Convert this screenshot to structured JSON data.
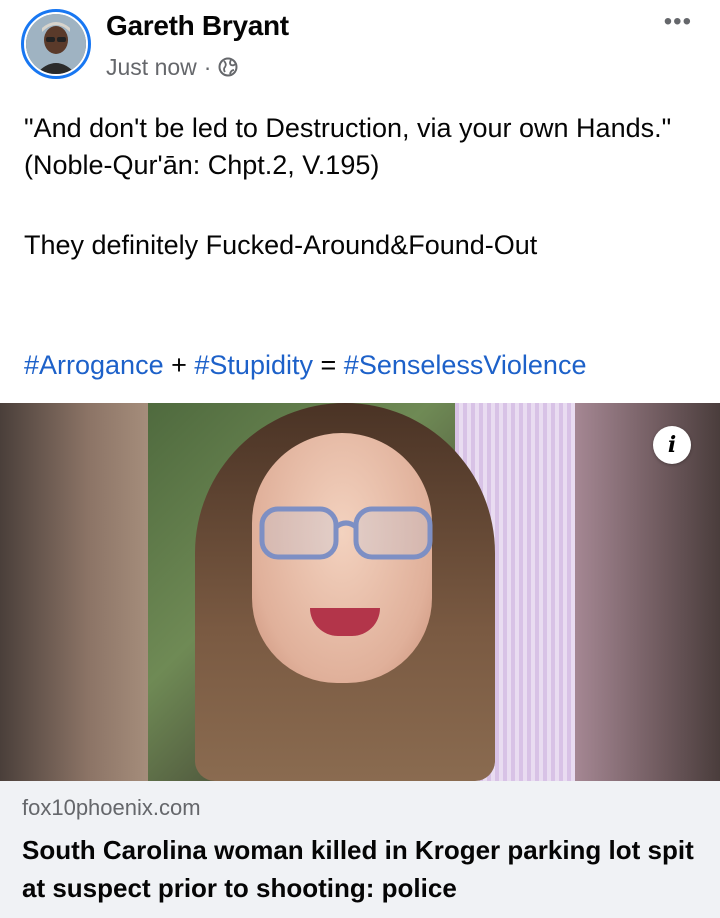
{
  "post": {
    "author": "Gareth Bryant",
    "timestamp": "Just now",
    "separator": "·",
    "audience_icon": "globe-icon",
    "more_icon": "ellipsis-icon",
    "more_label": "•••",
    "lines": [
      "\"And don't be led to Destruction, via your own Hands.\"",
      "(Noble-Qur'ān: Chpt.2, V.195)",
      "They definitely Fucked-Around&Found-Out"
    ],
    "hashtags": [
      "#Arrogance",
      "#Stupidity",
      "#SenselessViolence"
    ],
    "operators": [
      "+",
      "="
    ]
  },
  "link": {
    "info_label": "i",
    "domain": "fox10phoenix.com",
    "headline": "South Carolina woman killed in Kroger parking lot spit at suspect prior to shooting: police"
  },
  "colors": {
    "accent": "#1877f2",
    "hashtag": "#1d61c9",
    "secondary_text": "#65676b",
    "card_bg": "#f0f2f5"
  }
}
